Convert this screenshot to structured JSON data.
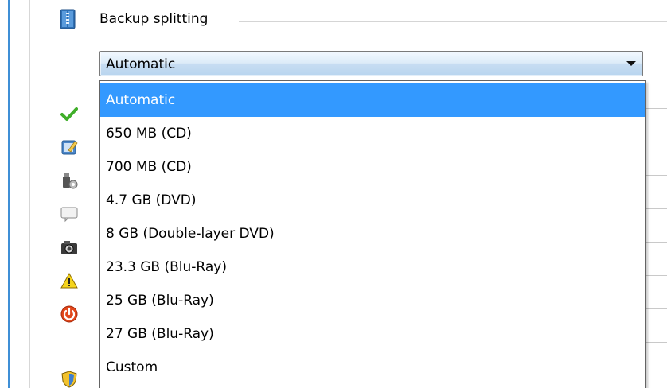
{
  "section": {
    "title": "Backup splitting",
    "icon": "archive-icon"
  },
  "combo": {
    "value": "Automatic"
  },
  "dropdown": {
    "options": [
      "Automatic",
      "650 MB (CD)",
      "700 MB (CD)",
      "4.7 GB (DVD)",
      "8 GB (Double-layer DVD)",
      "23.3 GB (Blu-Ray)",
      "25 GB (Blu-Ray)",
      "27 GB (Blu-Ray)",
      "Custom"
    ],
    "selected_index": 0
  },
  "sidebar_icons": [
    "checkmark-icon",
    "edit-document-icon",
    "usb-gear-icon",
    "comment-icon",
    "camera-icon",
    "warning-icon",
    "power-icon",
    "shield-icon"
  ],
  "colors": {
    "selection": "#3399ff",
    "accent_border": "#3f8fd6"
  }
}
